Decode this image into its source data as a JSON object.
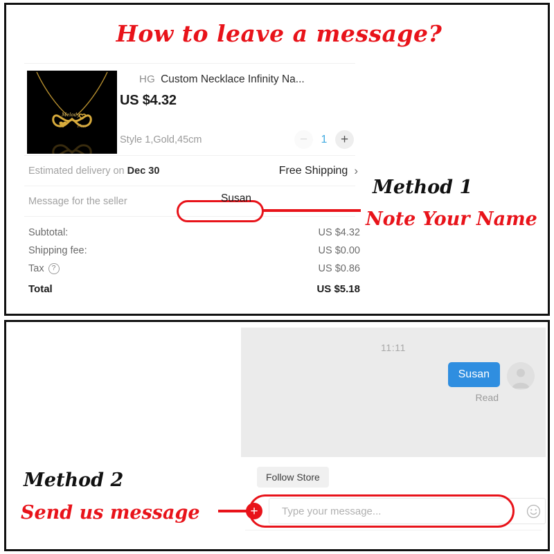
{
  "title": "How to leave a message?",
  "colors": {
    "annotation_red": "#e8131a",
    "bubble_blue": "#2f8ee0",
    "qty_blue": "#3fa9e0",
    "chat_bg": "#ebebeb"
  },
  "order": {
    "store_badge": "HG",
    "product_name": "Custom Necklace Infinity Na...",
    "price": "US $4.32",
    "variant": "Style 1,Gold,45cm",
    "quantity": "1",
    "qty_minus_label": "−",
    "qty_plus_label": "+",
    "delivery_label_prefix": "Estimated delivery on ",
    "delivery_date": "Dec 30",
    "shipping_value": "Free Shipping",
    "shipping_chevron": "›",
    "seller_message_label": "Message for the seller",
    "seller_message_value": "Susan",
    "totals": [
      {
        "label": "Subtotal:",
        "value": "US $4.32",
        "help": false,
        "grand": false
      },
      {
        "label": "Shipping fee:",
        "value": "US $0.00",
        "help": false,
        "grand": false
      },
      {
        "label": "Tax",
        "value": "US $0.86",
        "help": true,
        "grand": false
      },
      {
        "label": "Total",
        "value": "US $5.18",
        "help": false,
        "grand": true
      }
    ],
    "tax_help_glyph": "?"
  },
  "annotations": {
    "method1_title": "Method 1",
    "method1_sub": "Note Your Name",
    "method2_title": "Method 2",
    "method2_sub": "Send us message"
  },
  "chat": {
    "timestamp": "11:11",
    "message": "Susan",
    "status": "Read",
    "follow_store": "Follow Store",
    "plus_label": "+",
    "input_placeholder": "Type your message...",
    "input_value": ""
  }
}
